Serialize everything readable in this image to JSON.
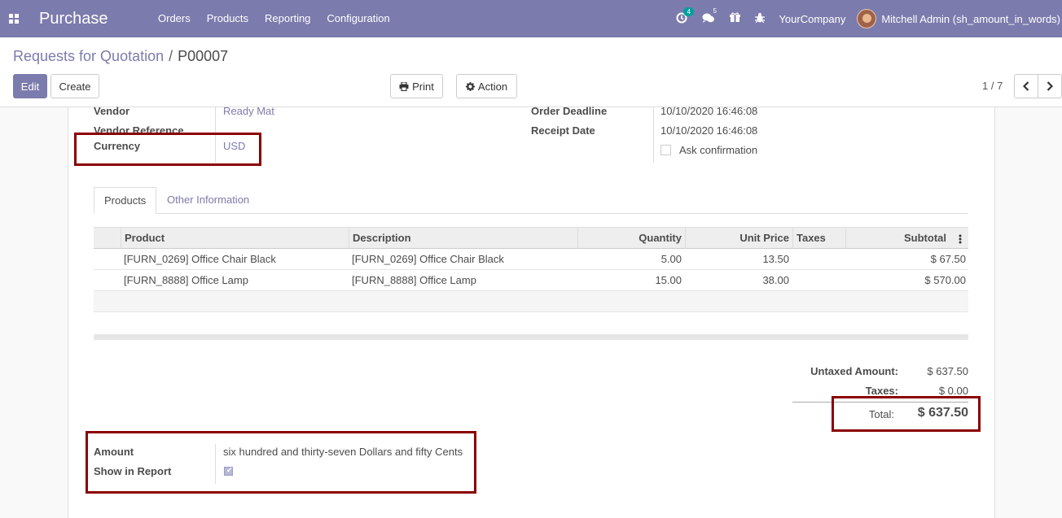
{
  "navbar": {
    "app_title": "Purchase",
    "menu": [
      "Orders",
      "Products",
      "Reporting",
      "Configuration"
    ],
    "activity_count": "4",
    "message_count": "5",
    "company": "YourCompany",
    "user": "Mitchell Admin (sh_amount_in_words)"
  },
  "breadcrumb": {
    "parent": "Requests for Quotation",
    "separator": "/",
    "current": "P00007"
  },
  "toolbar": {
    "edit": "Edit",
    "create": "Create",
    "print": "Print",
    "action": "Action",
    "pager": "1 / 7"
  },
  "form": {
    "vendor_label": "Vendor",
    "vendor_value": "Ready Mat",
    "vendor_ref_label": "Vendor Reference",
    "currency_label": "Currency",
    "currency_value": "USD",
    "order_deadline_label": "Order Deadline",
    "order_deadline_value": "10/10/2020 16:46:08",
    "receipt_date_label": "Receipt Date",
    "receipt_date_value": "10/10/2020 16:46:08",
    "ask_confirmation_label": "Ask confirmation"
  },
  "tabs": [
    "Products",
    "Other Information"
  ],
  "table": {
    "headers": [
      "Product",
      "Description",
      "Quantity",
      "Unit Price",
      "Taxes",
      "Subtotal"
    ],
    "rows": [
      [
        "[FURN_0269] Office Chair Black",
        "[FURN_0269] Office Chair Black",
        "5.00",
        "13.50",
        "",
        "$ 67.50"
      ],
      [
        "[FURN_8888] Office Lamp",
        "[FURN_8888] Office Lamp",
        "15.00",
        "38.00",
        "",
        "$ 570.00"
      ]
    ]
  },
  "totals": {
    "untaxed_label": "Untaxed Amount:",
    "untaxed_value": "$ 637.50",
    "taxes_label": "Taxes:",
    "taxes_value": "$ 0.00",
    "total_label": "Total:",
    "total_value": "$ 637.50"
  },
  "amount_words": {
    "amount_label": "Amount",
    "amount_value": "six hundred and thirty-seven Dollars and fifty Cents",
    "show_report_label": "Show in Report",
    "show_report_checked": true
  },
  "colors": {
    "brand": "#7c7bad",
    "highlight_box": "#8a0000"
  }
}
